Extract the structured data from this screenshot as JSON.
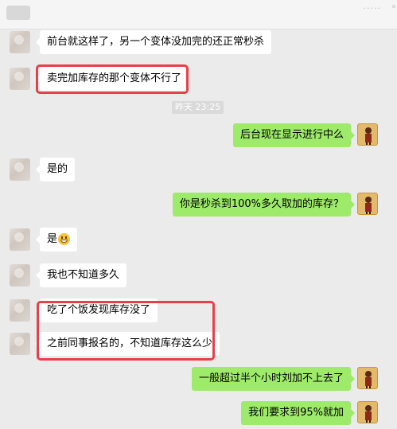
{
  "header": {
    "title": "",
    "menu_dots": "·····"
  },
  "messages": [
    {
      "side": "left",
      "text": "前台就这样了，另一个变体没加完的还正常秒杀"
    },
    {
      "side": "left",
      "text": "卖完加库存的那个变体不行了"
    },
    {
      "side": "right",
      "text": "后台现在显示进行中么"
    },
    {
      "side": "left",
      "text": "是的"
    },
    {
      "side": "right",
      "text": "你是秒杀到100%多久取加的库存？"
    },
    {
      "side": "left",
      "text": "是",
      "emoji": "grinning-face"
    },
    {
      "side": "left",
      "text": "我也不知道多久"
    },
    {
      "side": "left",
      "text": "吃了个饭发现库存没了"
    },
    {
      "side": "left",
      "text": "之前同事报名的，不知道库存这么少"
    },
    {
      "side": "right",
      "text": "一般超过半个小时刘加不上去了"
    },
    {
      "side": "right",
      "text": "我们要求到95%就加"
    }
  ],
  "timestamp": "昨天 23:25",
  "colors": {
    "background": "#ebebeb",
    "bubble_left": "#ffffff",
    "bubble_right": "#9eea6a",
    "highlight": "#e8404a"
  }
}
